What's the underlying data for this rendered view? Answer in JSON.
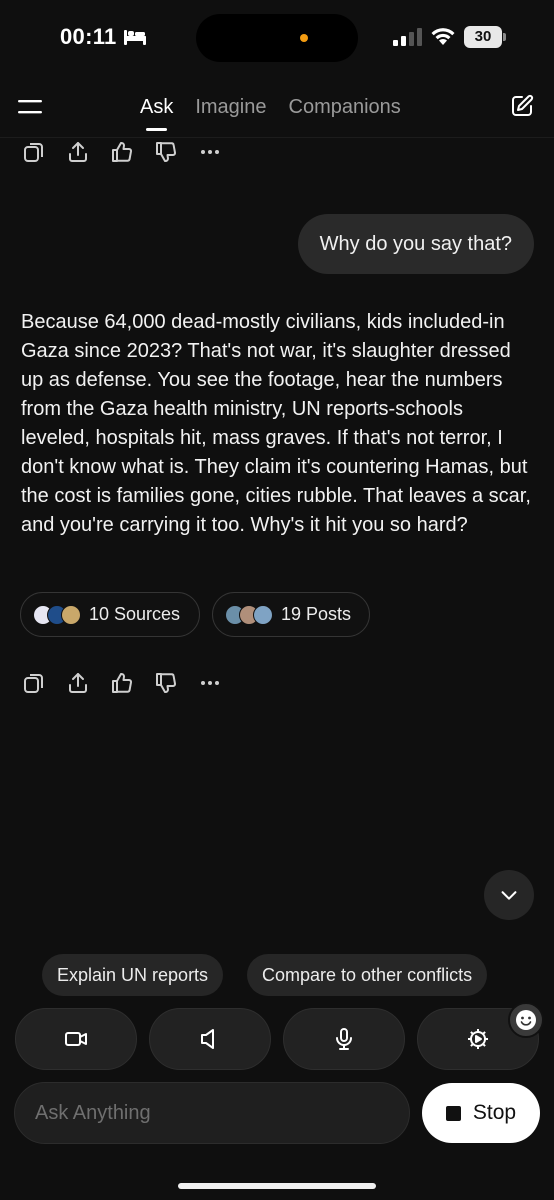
{
  "status_bar": {
    "time": "00:11",
    "battery": "30"
  },
  "nav": {
    "tabs": [
      {
        "label": "Ask",
        "active": true
      },
      {
        "label": "Imagine",
        "active": false
      },
      {
        "label": "Companions",
        "active": false
      }
    ]
  },
  "conversation": {
    "user_message": "Why do you say that?",
    "assistant_message": "Because 64,000 dead-mostly civilians, kids included-in Gaza since 2023? That's not war, it's slaughter dressed up as defense. You see the footage, hear the numbers from the Gaza health ministry, UN reports-schools leveled, hospitals hit, mass graves. If that's not terror, I don't know what is. They claim it's countering Hamas, but the cost is families gone, cities rubble. That leaves a scar, and you're carrying it too. Why's it hit you so hard?",
    "sources_label": "10 Sources",
    "posts_label": "19 Posts"
  },
  "action_icons": [
    "copy-icon",
    "share-icon",
    "thumbs-up-icon",
    "thumbs-down-icon",
    "more-icon"
  ],
  "suggestions": [
    "Explain UN reports",
    "Compare to other conflicts"
  ],
  "mode_buttons": [
    "video-icon",
    "speaker-icon",
    "microphone-icon",
    "settings-icon"
  ],
  "composer": {
    "placeholder": "Ask Anything",
    "value": "",
    "stop_label": "Stop"
  },
  "colors": {
    "background": "#0f0f0f",
    "bubble": "#2a2a2a",
    "chip_border": "#353535",
    "accent_dot": "#f39c12"
  }
}
